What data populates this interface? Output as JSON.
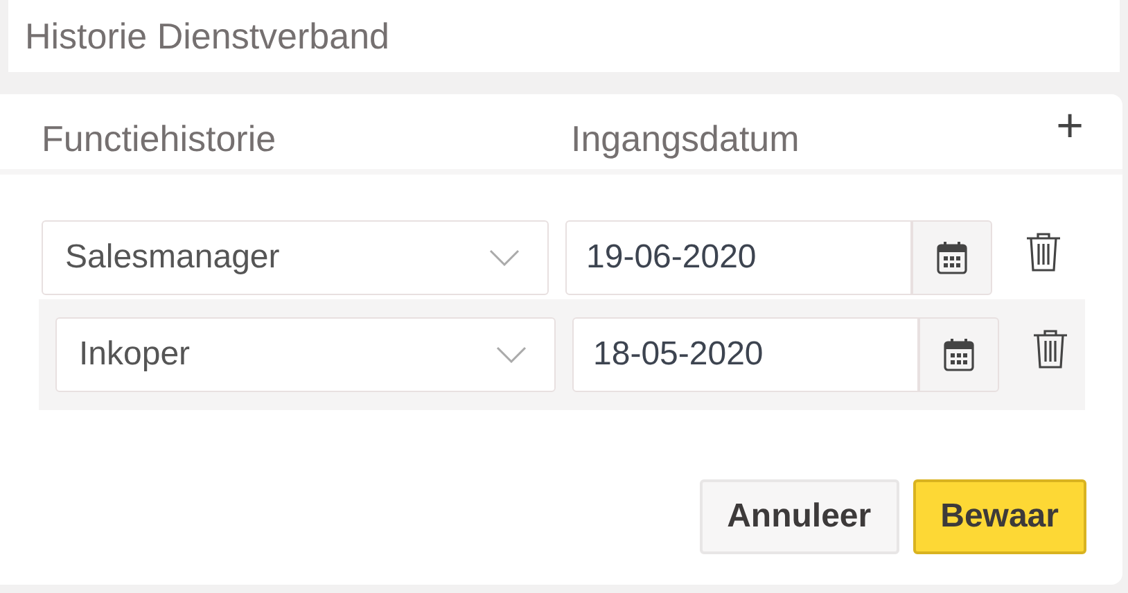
{
  "section_title": "Historie Dienstverband",
  "columns": [
    "Functiehistorie",
    "Ingangsdatum"
  ],
  "add_label": "+",
  "rows": [
    {
      "function": "Salesmanager",
      "date": "19-06-2020",
      "selected": false
    },
    {
      "function": "Inkoper",
      "date": "18-05-2020",
      "selected": true
    }
  ],
  "buttons": [
    {
      "label": "Annuleer",
      "kind": "secondary"
    },
    {
      "label": "Bewaar",
      "kind": "primary"
    }
  ]
}
